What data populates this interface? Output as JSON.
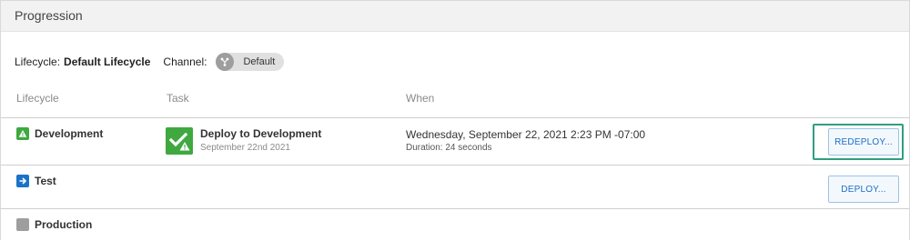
{
  "header": {
    "title": "Progression"
  },
  "meta": {
    "lifecycle_label": "Lifecycle:",
    "lifecycle_value": "Default Lifecycle",
    "channel_label": "Channel:",
    "channel_value": "Default",
    "channel_icon": "channel-fork-icon"
  },
  "columns": {
    "lifecycle": "Lifecycle",
    "task": "Task",
    "when": "When"
  },
  "rows": [
    {
      "phase": "Development",
      "phase_icon": "warning-icon",
      "phase_color": "#3fa83f",
      "task_name": "Deploy to Development",
      "task_date": "September 22nd 2021",
      "task_icon": "check-warning-icon",
      "when": "Wednesday, September 22, 2021 2:23 PM -07:00",
      "duration": "Duration: 24 seconds",
      "action": "REDEPLOY..."
    },
    {
      "phase": "Test",
      "phase_icon": "arrow-right-icon",
      "phase_color": "#1a73c9",
      "action": "DEPLOY..."
    },
    {
      "phase": "Production",
      "phase_icon": "square-icon",
      "phase_color": "#9e9e9e"
    }
  ],
  "colors": {
    "accent": "#1a6fc7",
    "success": "#3fa83f",
    "highlight": "#2f9e80"
  }
}
